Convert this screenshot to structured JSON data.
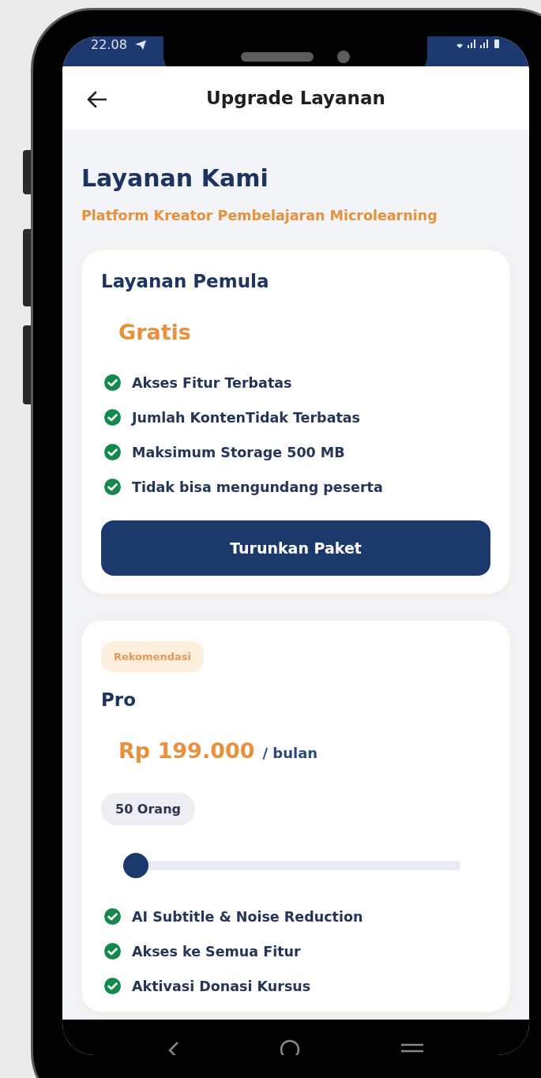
{
  "status_bar": {
    "time": "22.08"
  },
  "header": {
    "title": "Upgrade Layanan"
  },
  "intro": {
    "title": "Layanan Kami",
    "subtitle": "Platform Kreator Pembelajaran Microlearning"
  },
  "plans": [
    {
      "name": "Layanan Pemula",
      "price": "Gratis",
      "features": [
        "Akses Fitur Terbatas",
        "Jumlah KontenTidak Terbatas",
        "Maksimum Storage 500 MB",
        "Tidak bisa mengundang peserta"
      ],
      "button": "Turunkan Paket"
    },
    {
      "badge": "Rekomendasi",
      "name": "Pro",
      "price": "Rp 199.000",
      "period": "/ bulan",
      "participants": "50 Orang",
      "slider": {
        "level": 0
      },
      "features": [
        "AI Subtitle & Noise Reduction",
        "Akses ke Semua Fitur",
        "Aktivasi Donasi Kursus"
      ]
    }
  ]
}
